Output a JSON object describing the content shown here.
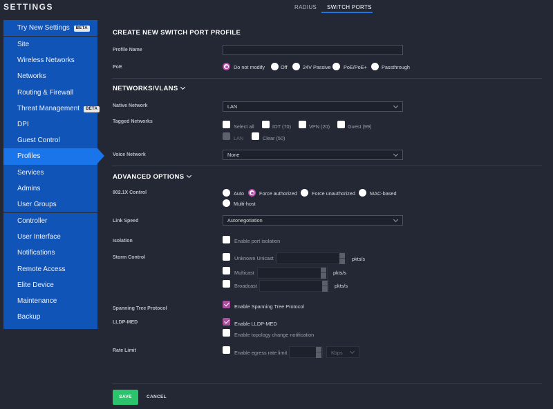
{
  "sidebar": {
    "title": "SETTINGS",
    "beta_label": "BETA",
    "try_new": "Try New Settings",
    "items_a": [
      "Site",
      "Wireless Networks",
      "Networks",
      "Routing & Firewall",
      "Threat Management",
      "DPI",
      "Guest Control",
      "Profiles",
      "Services",
      "Admins",
      "User Groups"
    ],
    "items_b": [
      "Controller",
      "User Interface",
      "Notifications",
      "Remote Access",
      "Elite Device",
      "Maintenance",
      "Backup"
    ],
    "active": "Profiles"
  },
  "tabs": {
    "radius": "RADIUS",
    "switch_ports": "SWITCH PORTS",
    "active": "SWITCH PORTS"
  },
  "form": {
    "title": "CREATE NEW SWITCH PORT PROFILE",
    "profile_name": {
      "label": "Profile Name",
      "value": ""
    },
    "poe": {
      "label": "PoE",
      "options": [
        "Do not modify",
        "Off",
        "24V Passive",
        "PoE/PoE+",
        "Passthrough"
      ],
      "selected": "Do not modify"
    },
    "networks_header": "NETWORKS/VLANS",
    "native_network": {
      "label": "Native Network",
      "value": "LAN"
    },
    "tagged_networks": {
      "label": "Tagged Networks",
      "options": [
        "Select all",
        "IOT (70)",
        "VPN (20)",
        "Guest (99)",
        "LAN",
        "Clear (50)"
      ],
      "disabled": [
        "LAN"
      ]
    },
    "voice_network": {
      "label": "Voice Network",
      "value": "None"
    },
    "advanced_header": "ADVANCED OPTIONS",
    "dot1x": {
      "label": "802.1X Control",
      "options": [
        "Auto",
        "Force authorized",
        "Force unauthorized",
        "MAC-based",
        "Multi-host"
      ],
      "selected": "Force authorized"
    },
    "link_speed": {
      "label": "Link Speed",
      "value": "Autonegotiation"
    },
    "isolation": {
      "label": "Isolation",
      "option": "Enable port isolation",
      "checked": false
    },
    "storm_control": {
      "label": "Storm Control",
      "rows": [
        "Unknown Unicast",
        "Multicast",
        "Broadcast"
      ],
      "unit": "pkts/s"
    },
    "stp": {
      "label": "Spanning Tree Protocol",
      "option": "Enable Spanning Tree Protocol",
      "checked": true
    },
    "lldp": {
      "label": "LLDP-MED",
      "option": "Enable LLDP-MED",
      "checked": true,
      "option2": "Enable topology change notification",
      "checked2": false
    },
    "rate_limit": {
      "label": "Rate Limit",
      "option": "Enable egress rate limit",
      "unit": "Kbps",
      "checked": false
    }
  },
  "actions": {
    "save": "SAVE",
    "cancel": "CANCEL"
  },
  "colors": {
    "sidebar_blue": "#1054b8",
    "active_blue": "#1a75ea",
    "save_green": "#2bc46d",
    "check_purple": "#a84f9e",
    "background": "#242834"
  }
}
